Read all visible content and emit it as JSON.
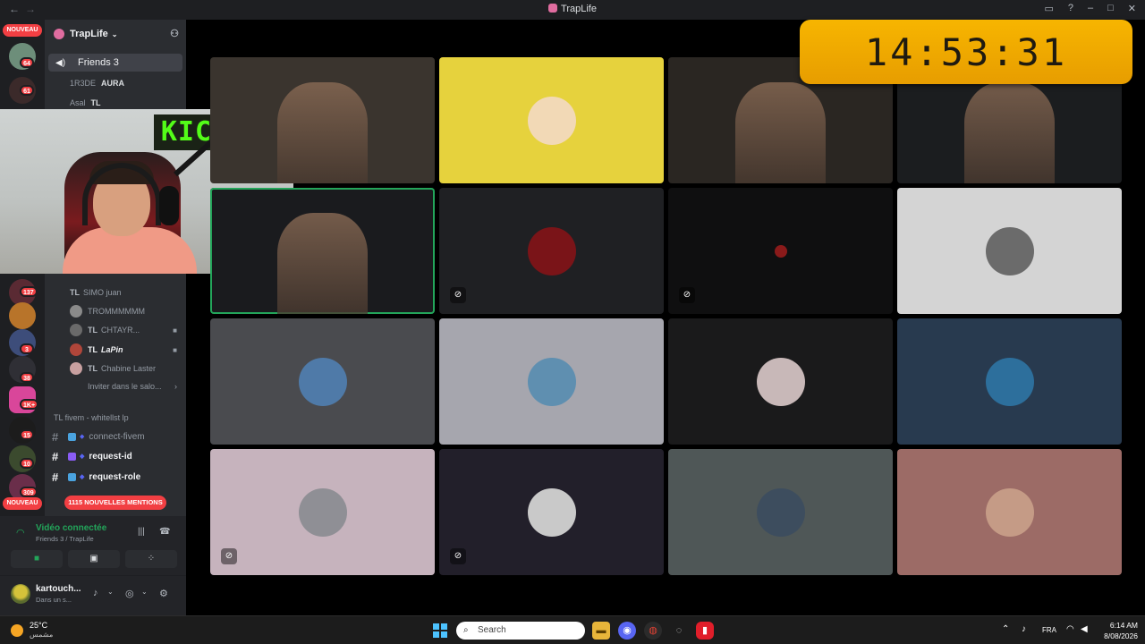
{
  "window": {
    "title": "TrapLife"
  },
  "server": {
    "name": "TrapLife",
    "badge_new": "NOUVEAU",
    "badge_new_bottom": "NOUVEAU"
  },
  "server_badges": [
    "64",
    "61",
    "137",
    "3",
    "38",
    "1K+",
    "15",
    "10",
    "309"
  ],
  "voice_channel": {
    "name": "Friends 3"
  },
  "voice_users_top": [
    {
      "tag": "",
      "name": "1R3DE",
      "extra": "AURA"
    },
    {
      "tag": "",
      "name": "Asal",
      "extra": "TL"
    }
  ],
  "voice_users": [
    {
      "tag": "TL",
      "name": "SIMO juan"
    },
    {
      "tag": "",
      "name": "TROMMMMMM"
    },
    {
      "tag": "TL",
      "name": "CHTAYR..."
    },
    {
      "tag": "TL",
      "name": "LaPin"
    },
    {
      "tag": "TL",
      "name": "Chabine Laster"
    }
  ],
  "invite_text": "Inviter dans le salo...",
  "category": "TL fivem - whitellst lp",
  "text_channels": [
    {
      "name": "connect-fivem",
      "bold": false
    },
    {
      "name": "request-id",
      "bold": true
    },
    {
      "name": "request-role",
      "bold": true
    }
  ],
  "mentions": "1115 NOUVELLES MENTIONS",
  "voice_status": {
    "title": "Vidéo connectée",
    "subtitle": "Friends 3 / TrapLife"
  },
  "user": {
    "name": "kartouch...",
    "status": "Dans un s..."
  },
  "webcam": {
    "logo": "KICK"
  },
  "clock": {
    "time": "14:53:31"
  },
  "tiles": [
    {
      "kind": "video",
      "bg": "#3a342e",
      "speaking": false,
      "muted": false
    },
    {
      "kind": "avatar",
      "bg": "#e6d23d",
      "avatar": "#f2d9b6",
      "speaking": false,
      "muted": false
    },
    {
      "kind": "video",
      "bg": "#2a2622",
      "speaking": false,
      "muted": false
    },
    {
      "kind": "video",
      "bg": "#1b1d1f",
      "speaking": false,
      "muted": false
    },
    {
      "kind": "video",
      "bg": "#1a1b1e",
      "speaking": true,
      "muted": false
    },
    {
      "kind": "avatar",
      "bg": "#1f2023",
      "avatar": "#7a1418",
      "speaking": false,
      "muted": true
    },
    {
      "kind": "avatar-small",
      "bg": "#0f0f10",
      "avatar": "#8a1a1a",
      "speaking": false,
      "muted": true
    },
    {
      "kind": "avatar",
      "bg": "#d4d4d4",
      "avatar": "#6b6b6b",
      "speaking": false,
      "muted": false
    },
    {
      "kind": "avatar",
      "bg": "#4a4b4f",
      "avatar": "#4f7aa8",
      "speaking": false,
      "muted": false
    },
    {
      "kind": "avatar",
      "bg": "#a6a6ae",
      "avatar": "#5f8fb0",
      "speaking": false,
      "muted": false
    },
    {
      "kind": "avatar",
      "bg": "#1a1a1b",
      "avatar": "#c8b8b8",
      "speaking": false,
      "muted": false
    },
    {
      "kind": "avatar",
      "bg": "#283a4f",
      "avatar": "#2d6f9c",
      "speaking": false,
      "muted": false
    },
    {
      "kind": "avatar",
      "bg": "#c6b3bd",
      "avatar": "#8f8f95",
      "speaking": false,
      "muted": true
    },
    {
      "kind": "avatar",
      "bg": "#221f2a",
      "avatar": "#c9c9c9",
      "speaking": false,
      "muted": true
    },
    {
      "kind": "avatar",
      "bg": "#4f5757",
      "avatar": "#3d4d5e",
      "speaking": false,
      "muted": false
    },
    {
      "kind": "avatar",
      "bg": "#9c6b66",
      "avatar": "#c59b86",
      "speaking": false,
      "muted": false
    }
  ],
  "taskbar": {
    "temp": "25°C",
    "weather": "مشمس",
    "search_placeholder": "Search",
    "lang": "FRA",
    "time": "6:14 AM",
    "date": "8/08/2026"
  }
}
